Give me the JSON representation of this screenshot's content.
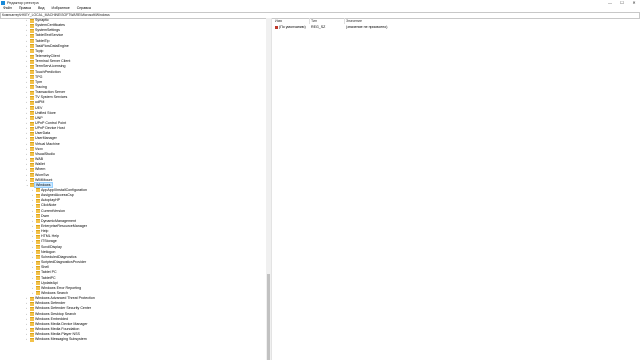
{
  "window": {
    "title": "Редактор реестра",
    "controls": [
      "—",
      "☐",
      "✕"
    ]
  },
  "menu": [
    "Файл",
    "Правка",
    "Вид",
    "Избранное",
    "Справка"
  ],
  "address": "Компьютер\\HKEY_LOCAL_MACHINE\\SOFTWARE\\Microsoft\\Windows",
  "tree": {
    "level1": [
      "Synaptic",
      "SystemCertificates",
      "SystemSettings",
      "TabletTextService",
      "TabletTip",
      "TaskFlowDataEngine",
      "Tcpip",
      "TelemetryClient",
      "Terminal Server Client",
      "TermServLicensing",
      "TouchPrediction",
      "TPG",
      "Tpm",
      "Tracing",
      "Transaction Server",
      "TV System Services",
      "udPM",
      "UEV",
      "Unified Store",
      "UNP",
      "UPnP Control Point",
      "UPnP Device Host",
      "UserData",
      "UserManager",
      "Virtual Machine",
      "Vsxx",
      "VisualStudio",
      "WAB",
      "Wallet",
      "Wbem",
      "WcmSvc",
      "WIMMount"
    ],
    "selected": "Windows",
    "children": [
      "AppAppXInstallConfiguration",
      "AssignedAccessCsp",
      "AutoplayHP",
      "ClickNote",
      "CurrentVersion",
      "Dwm",
      "DynamicManagement",
      "EnterpriseResourceManager",
      "Help",
      "HTML Help",
      "ITStorage",
      "ScrollDisplay",
      "Netlogon",
      "ScheduledDiagnostics",
      "ScriptedDiagnosticsProvider",
      "Shell",
      "Tablet PC",
      "TabletPC",
      "UpdateApi",
      "Windows Error Reporting",
      "Windows Search"
    ],
    "after": [
      "Windows Advanced Threat Protection",
      "Windows Defender",
      "Windows Defender Security Center",
      "Windows Desktop Search",
      "Windows Embedded",
      "Windows Media Device Manager",
      "Windows Media Foundation",
      "Windows Media Player NSS",
      "Windows Messaging Subsystem"
    ]
  },
  "list": {
    "headers": [
      "Имя",
      "Тип",
      "Значение"
    ],
    "rows": [
      {
        "name": "(По умолчанию)",
        "type": "REG_SZ",
        "value": "(значение не присвоено)"
      }
    ]
  }
}
